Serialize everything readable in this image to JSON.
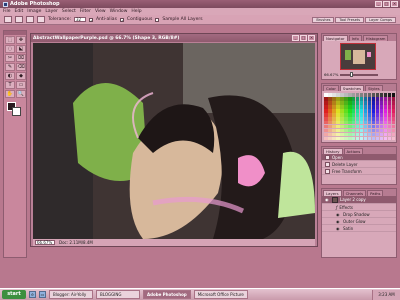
{
  "app": {
    "title": "Adobe Photoshop"
  },
  "menu": [
    "File",
    "Edit",
    "Image",
    "Layer",
    "Select",
    "Filter",
    "View",
    "Window",
    "Help"
  ],
  "options": {
    "tolerance_label": "Tolerance:",
    "tolerance_value": "32",
    "anti_alias_label": "Anti-alias",
    "contiguous_label": "Contiguous",
    "sample_all_label": "Sample All Layers",
    "palette_tabs": [
      "Brushes",
      "Tool Presets",
      "Layer Comps"
    ]
  },
  "document": {
    "title": "AbstractWallpaperPurple.psd @ 66.7% (Shape 3, RGB/8#)",
    "zoom": "66.67%",
    "doc_info": "Doc: 2.11M/8.4M"
  },
  "navigator": {
    "tabs": [
      "Navigator",
      "Info",
      "Histogram"
    ],
    "zoom": "66.67%"
  },
  "swatches_panel": {
    "tabs": [
      "Color",
      "Swatches",
      "Styles"
    ]
  },
  "history": {
    "tabs": [
      "History",
      "Actions"
    ],
    "items": [
      "Open",
      "Delete Layer",
      "Free Transform"
    ]
  },
  "layers": {
    "tabs": [
      "Layers",
      "Channels",
      "Paths"
    ],
    "items": [
      {
        "name": "Layer 2 copy",
        "kind": "layer"
      },
      {
        "name": "Effects",
        "kind": "fx"
      },
      {
        "name": "Drop Shadow",
        "kind": "effect"
      },
      {
        "name": "Outer Glow",
        "kind": "effect"
      },
      {
        "name": "Satin",
        "kind": "effect"
      }
    ]
  },
  "toolbox": {
    "tools": [
      "⬚",
      "✥",
      "◌",
      "⬕",
      "✂",
      "⌧",
      "✎",
      "⌫",
      "◐",
      "◆",
      "T",
      "▭",
      "✋",
      "🔍"
    ]
  },
  "taskbar": {
    "start_label": "start",
    "tasks": [
      "Blogger: Air-Yolly",
      "BLOGGING",
      "Adobe Photoshop",
      "Microsoft Office Picture"
    ],
    "active_task": "Adobe Photoshop",
    "clock": "3:23 AM"
  },
  "colors": {
    "accent": "#8f5a6e",
    "chrome": "#d8a8b9",
    "background": "#b8788e"
  }
}
